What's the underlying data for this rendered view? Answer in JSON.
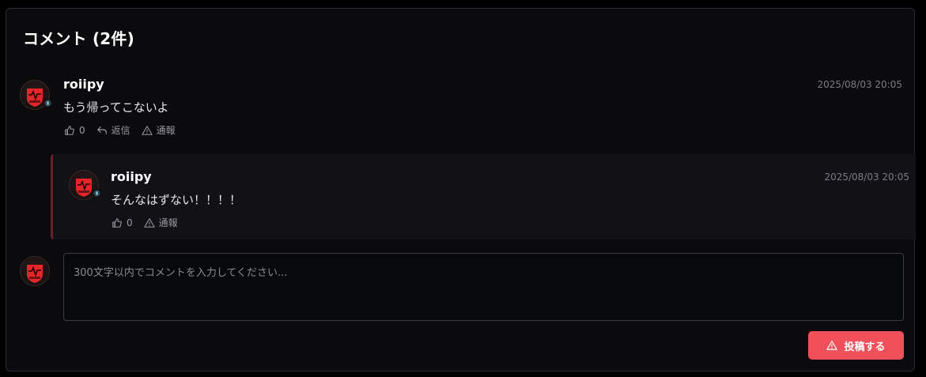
{
  "header": {
    "title": "コメント (2件)"
  },
  "comments": [
    {
      "author": "roiipy",
      "timestamp": "2025/08/03 20:05",
      "text": "もう帰ってこないよ",
      "likes": "0",
      "reply_label": "返信",
      "report_label": "通報"
    }
  ],
  "replies": [
    {
      "author": "roiipy",
      "timestamp": "2025/08/03 20:05",
      "text": "そんなはずない！！！！",
      "likes": "0",
      "report_label": "通報"
    }
  ],
  "composer": {
    "placeholder": "300文字以内でコメントを入力してください...",
    "submit_label": "投稿する"
  },
  "colors": {
    "submit_bg": "#f0505a",
    "reply_accent": "#6b1f27",
    "avatar_red": "#e8242b"
  },
  "icons": [
    "thumbs-up-icon",
    "reply-arrow-icon",
    "warning-triangle-icon"
  ]
}
